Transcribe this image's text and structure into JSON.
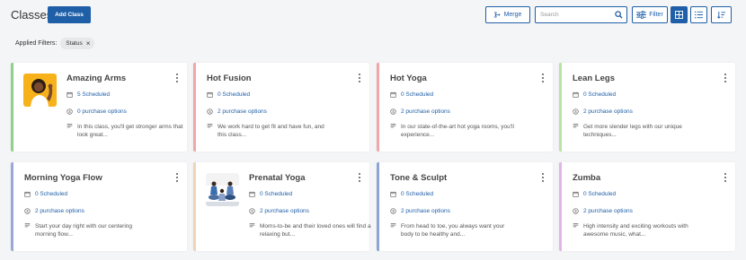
{
  "header": {
    "title": "Classes",
    "add_label": "Add Class",
    "merge_label": "Merge",
    "search_placeholder": "Search",
    "filter_label": "Filter"
  },
  "filters": {
    "label": "Applied Filters:",
    "chips": [
      {
        "label": "Status"
      }
    ]
  },
  "colors": {
    "accent": "#1f5fa8",
    "card_borders": [
      "#8fd18a",
      "#f0a7a7",
      "#f2a6a6",
      "#b9e3a2",
      "#9aa8d9",
      "#efd4b8",
      "#8fa5d8",
      "#e1b6e6"
    ]
  },
  "cards": [
    {
      "name": "Amazing Arms",
      "scheduled": "5 Scheduled",
      "purchase": "0 purchase options",
      "desc": "In this class, you'll get stronger arms that look great...",
      "image": "woman-flexing-arm"
    },
    {
      "name": "Hot Fusion",
      "scheduled": "0 Scheduled",
      "purchase": "2 purchase options",
      "desc": "We work hard to get fit and have fun, and this class..."
    },
    {
      "name": "Hot Yoga",
      "scheduled": "0 Scheduled",
      "purchase": "2 purchase options",
      "desc": "In our state-of-the-art hot yoga rooms, you'll experience..."
    },
    {
      "name": "Lean Legs",
      "scheduled": "0 Scheduled",
      "purchase": "2 purchase options",
      "desc": "Get more slender legs with our unique techniques..."
    },
    {
      "name": "Morning Yoga Flow",
      "scheduled": "0 Scheduled",
      "purchase": "2 purchase options",
      "desc": "Start your day right with our centering morning flow..."
    },
    {
      "name": "Prenatal Yoga",
      "scheduled": "0 Scheduled",
      "purchase": "2 purchase options",
      "desc": "Moms-to-be and their loved ones will find a relaxing but...",
      "image": "prenatal-yoga-class"
    },
    {
      "name": "Tone & Sculpt",
      "scheduled": "0 Scheduled",
      "purchase": "2 purchase options",
      "desc": "From head to toe, you always want your body to be healthy and..."
    },
    {
      "name": "Zumba",
      "scheduled": "0 Scheduled",
      "purchase": "2 purchase options",
      "desc": "High intensity and exciting workouts with awesome music, what..."
    }
  ]
}
